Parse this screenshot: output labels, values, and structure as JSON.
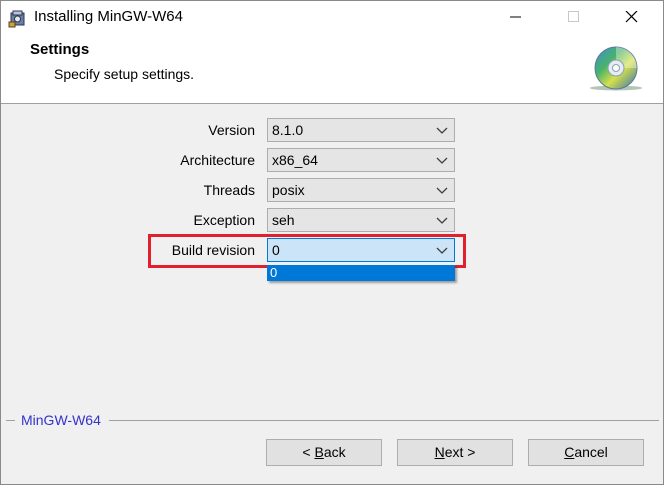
{
  "window": {
    "title": "Installing MinGW-W64"
  },
  "header": {
    "title": "Settings",
    "subtitle": "Specify setup settings."
  },
  "form": {
    "fields": [
      {
        "label": "Version",
        "value": "8.1.0"
      },
      {
        "label": "Architecture",
        "value": "x86_64"
      },
      {
        "label": "Threads",
        "value": "posix"
      },
      {
        "label": "Exception",
        "value": "seh"
      },
      {
        "label": "Build revision",
        "value": "0"
      }
    ],
    "open_dropdown": {
      "options": [
        "0"
      ]
    }
  },
  "footer": {
    "brand": "MinGW-W64",
    "back": {
      "pre": "< ",
      "key": "B",
      "post": "ack"
    },
    "next": {
      "key": "N",
      "post": "ext >"
    },
    "cancel": {
      "key": "C",
      "post": "ancel"
    }
  },
  "colors": {
    "highlight": "#e0202e",
    "selection": "#0078d7",
    "brand": "#3333cc"
  },
  "icons": {
    "app": "installer-icon",
    "header": "cd-disc-icon"
  }
}
